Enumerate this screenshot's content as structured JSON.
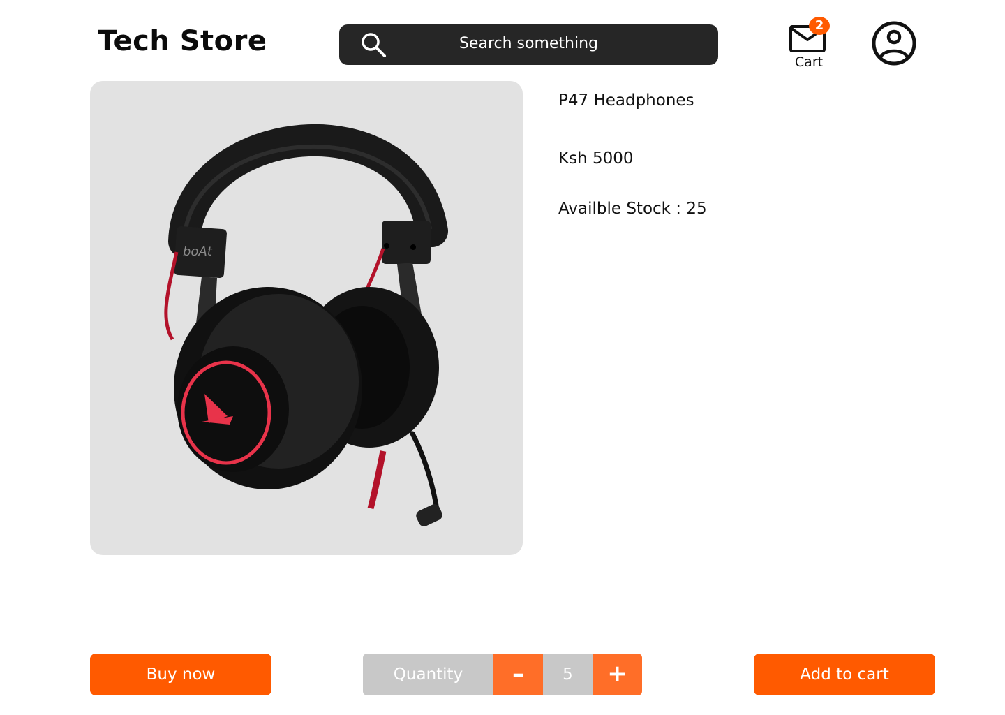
{
  "header": {
    "logo": "Tech Store",
    "search": {
      "placeholder": "Search something",
      "icon": "search-icon"
    },
    "cart": {
      "label": "Cart",
      "badge_count": "2",
      "icon": "mail-icon"
    },
    "profile": {
      "icon": "user-circle-icon"
    }
  },
  "product": {
    "name": "P47 Headphones",
    "price": "Ksh 5000",
    "stock": "Availble Stock : 25",
    "image": {
      "brand_logo": "boAt"
    }
  },
  "actions": {
    "buy_now": "Buy now",
    "quantity_label": "Quantity",
    "decrement": "–",
    "quantity_value": "5",
    "increment": "+",
    "add_to_cart": "Add to cart"
  },
  "colors": {
    "accent": "#ff5a00",
    "accent_light": "#ff6e28",
    "search_bg": "#262626",
    "image_bg": "#e2e2e2",
    "quantity_bg": "#c8c8c8"
  }
}
